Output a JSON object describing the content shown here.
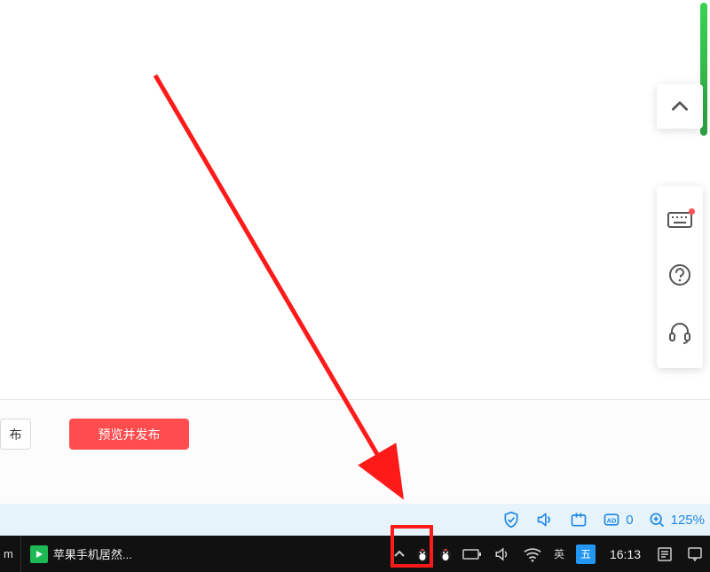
{
  "app": {
    "publish_button": "预览并发布",
    "secondary_button_tail": "布"
  },
  "float_tools": {
    "up": "chevron-up",
    "keyboard": "keyboard",
    "help": "help",
    "support": "headset"
  },
  "browser_status": {
    "shield": "shield",
    "volume": "volume",
    "snapshot": "snapshot",
    "ad_label": "0",
    "zoom_label": "125%"
  },
  "taskbar": {
    "partial_app_tail": "m",
    "app_title": "苹果手机居然...",
    "ime_small": "英",
    "ime_badge": "五",
    "clock": "16:13"
  }
}
